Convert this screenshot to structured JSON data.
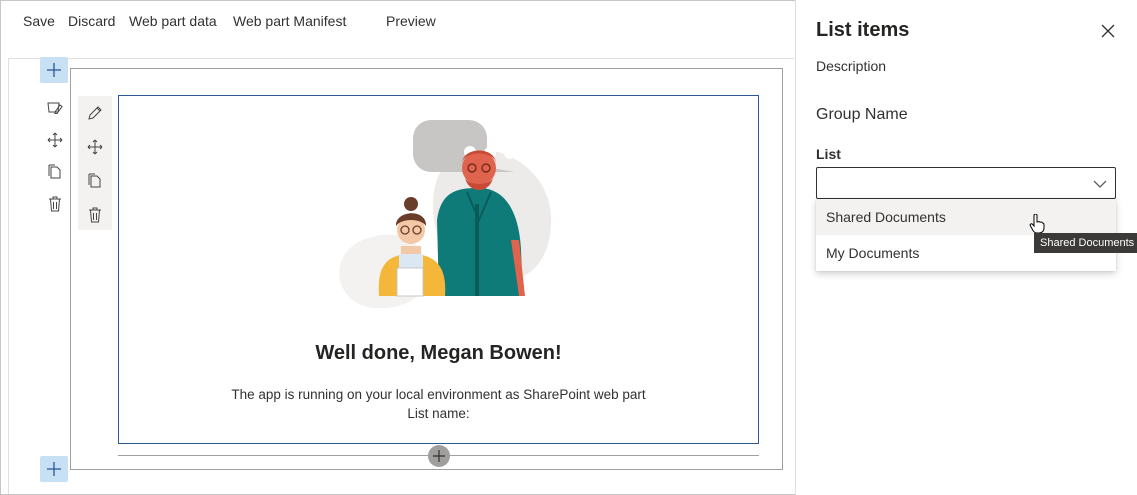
{
  "toolbar": {
    "save_label": "Save",
    "discard_label": "Discard",
    "webpart_data_label": "Web part data",
    "webpart_manifest_label": "Web part Manifest",
    "preview_label": "Preview"
  },
  "webpart": {
    "title": "Well done, Megan Bowen!",
    "description": "The app is running on your local environment as SharePoint web part",
    "list_name_label": "List name:"
  },
  "property_pane": {
    "title": "List items",
    "description": "Description",
    "group_name": "Group Name",
    "list_field": {
      "label": "List",
      "selected": "",
      "options": [
        "Shared Documents",
        "My Documents"
      ],
      "hovered_option": "Shared Documents"
    },
    "tooltip": "Shared Documents"
  },
  "colors": {
    "accent": "#2b5797",
    "add_button": "#c7e0f4",
    "hair": "#e0634d",
    "hoodie": "#0f7b79",
    "jacket": "#f4b73a"
  },
  "icons": {
    "add": "plus-icon",
    "edit": "pencil-icon",
    "move": "move-icon",
    "duplicate": "copy-icon",
    "delete": "trash-icon",
    "close": "close-icon",
    "chevron": "chevron-down-icon"
  }
}
